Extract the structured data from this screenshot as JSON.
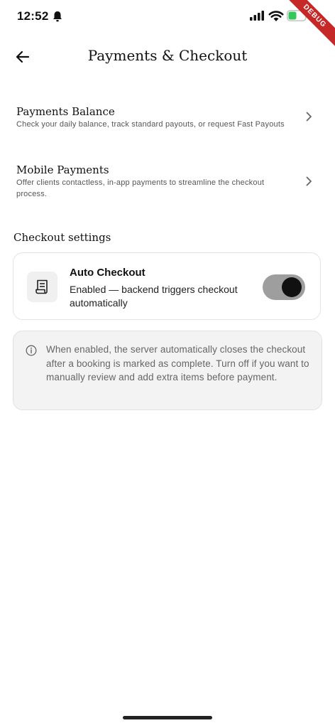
{
  "status_bar": {
    "time": "12:52",
    "debug_label": "DEBUG"
  },
  "header": {
    "title": "Payments & Checkout"
  },
  "menu": [
    {
      "title": "Payments Balance",
      "subtitle": "Check your daily balance, track standard payouts, or request Fast Payouts"
    },
    {
      "title": "Mobile Payments",
      "subtitle": "Offer clients contactless, in-app payments to streamline the checkout process."
    }
  ],
  "checkout_settings": {
    "section_title": "Checkout settings",
    "auto_checkout": {
      "title": "Auto Checkout",
      "subtitle": "Enabled — backend triggers checkout automatically",
      "enabled": true
    },
    "info_text": "When enabled, the server automatically closes the checkout after a booking is marked as complete. Turn off if you want to manually review and add extra items before payment."
  },
  "colors": {
    "toggle_track": "#9e9e9e",
    "toggle_knob": "#111111",
    "debug_banner": "#c62828",
    "battery": "#34c759"
  }
}
